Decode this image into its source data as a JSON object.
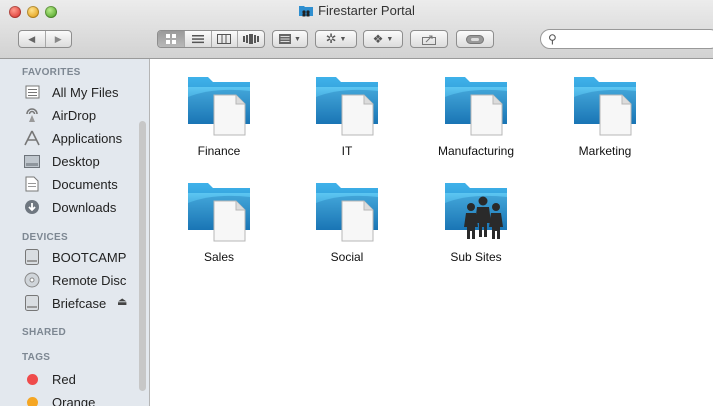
{
  "window": {
    "title": "Firestarter Portal"
  },
  "toolbar": {
    "search_placeholder": ""
  },
  "sidebar": {
    "favorites_header": "FAVORITES",
    "favorites": [
      {
        "label": "All My Files",
        "icon": "all-my-files-icon"
      },
      {
        "label": "AirDrop",
        "icon": "airdrop-icon"
      },
      {
        "label": "Applications",
        "icon": "applications-icon"
      },
      {
        "label": "Desktop",
        "icon": "desktop-icon"
      },
      {
        "label": "Documents",
        "icon": "documents-icon"
      },
      {
        "label": "Downloads",
        "icon": "downloads-icon"
      }
    ],
    "devices_header": "DEVICES",
    "devices": [
      {
        "label": "BOOTCAMP",
        "icon": "disk-icon"
      },
      {
        "label": "Remote Disc",
        "icon": "remote-disc-icon"
      },
      {
        "label": "Briefcase",
        "icon": "disk-icon",
        "eject_symbol": "⏏"
      }
    ],
    "shared_header": "SHARED",
    "tags_header": "TAGS",
    "tags": [
      {
        "label": "Red",
        "color": "#ef4b4b"
      },
      {
        "label": "Orange",
        "color": "#f5a623"
      }
    ]
  },
  "content": {
    "items": [
      {
        "name": "Finance",
        "icon": "folder-icon"
      },
      {
        "name": "IT",
        "icon": "folder-icon"
      },
      {
        "name": "Manufacturing",
        "icon": "folder-icon"
      },
      {
        "name": "Marketing",
        "icon": "folder-icon"
      },
      {
        "name": "Sales",
        "icon": "folder-icon"
      },
      {
        "name": "Social",
        "icon": "folder-icon"
      },
      {
        "name": "Sub Sites",
        "icon": "sub-sites-people-icon"
      }
    ]
  },
  "colors": {
    "folder_blue": "#2f9bd8",
    "sidebar_bg": "#e3e8ee"
  }
}
